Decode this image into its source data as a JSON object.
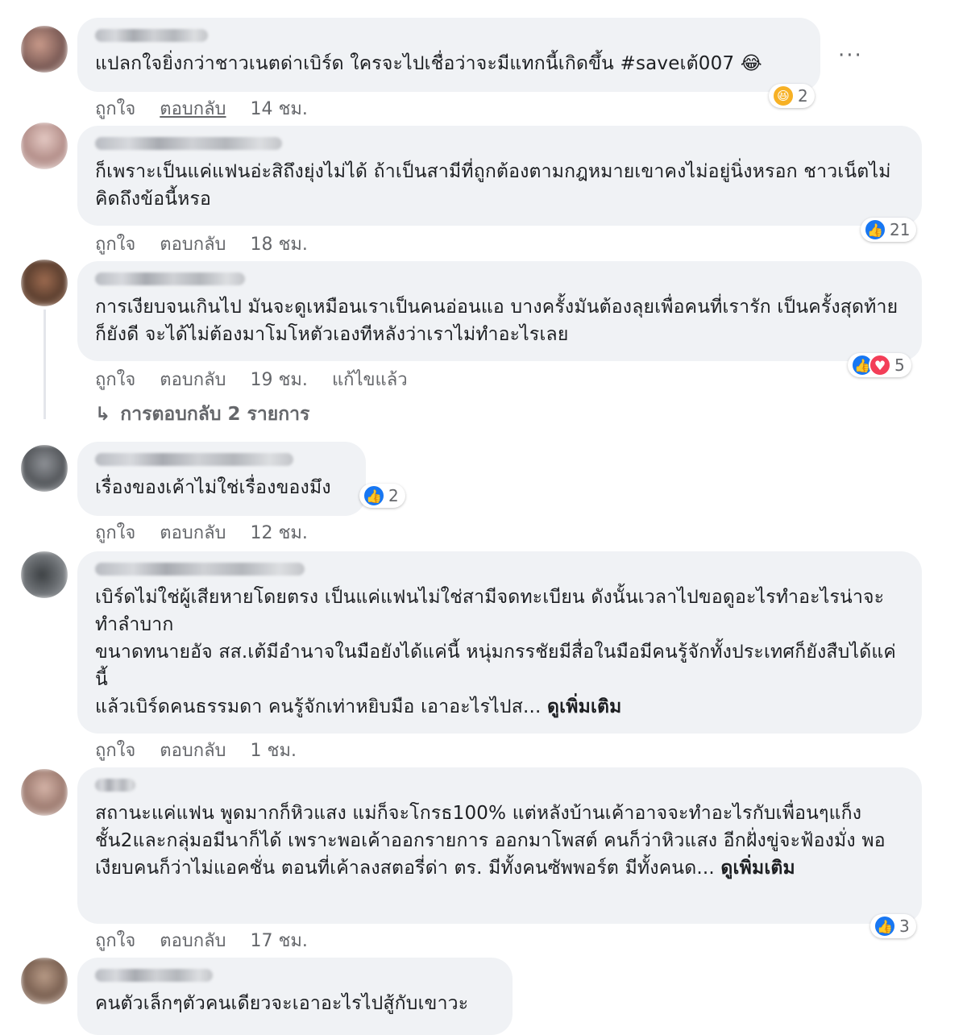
{
  "common": {
    "like_label": "ถูกใจ",
    "reply_label": "ตอบกลับ"
  },
  "colors": {
    "bubble_bg": "#f0f2f5",
    "like_blue": "#1877f2",
    "love_red": "#f33e58",
    "haha_yellow": "#f7b125",
    "meta_gray": "#65676b"
  },
  "comments": [
    {
      "text": "แปลกใจยิ่งกว่าชาวเนตด่าเบิร์ด ใครจะไปเชื่อว่าจะมีแทกนี้เกิดขึ้น #saveเต้007 😂",
      "time": "14 ชม.",
      "reaction_count": "2",
      "reaction_icons": [
        "haha-icon"
      ],
      "more_label": "···"
    },
    {
      "text": "ก็เพราะเป็นแค่แฟนอ่ะสิถึงยุ่งไม่ได้ ถ้าเป็นสามีที่ถูกต้องตามกฎหมายเขาคงไม่อยู่นิ่งหรอก ชาวเน็ตไม่คิดถึงข้อนี้หรอ",
      "time": "18 ชม.",
      "reaction_count": "21",
      "reaction_icons": [
        "like-icon"
      ]
    },
    {
      "text": "การเงียบจนเกินไป มันจะดูเหมือนเราเป็นคนอ่อนแอ บางครั้งมันต้องลุยเพื่อคนที่เรารัก เป็นครั้งสุดท้ายก็ยังดี จะได้ไม่ต้องมาโมโหตัวเองทีหลังว่าเราไม่ทำอะไรเลย",
      "time": "19 ชม.",
      "edited": "แก้ไขแล้ว",
      "reaction_count": "5",
      "reaction_icons": [
        "like-icon",
        "love-icon"
      ],
      "replies_label": "การตอบกลับ 2 รายการ"
    },
    {
      "text": "เรื่องของเค้าไม่ใช่เรื่องของมึง",
      "time": "12 ชม.",
      "reaction_count": "2",
      "reaction_icons": [
        "like-icon"
      ]
    },
    {
      "text": "เบิร์ดไม่ใช่ผู้เสียหายโดยตรง เป็นแค่แฟนไม่ใช่สามีจดทะเบียน ดังนั้นเวลาไปขอดูอะไรทำอะไรน่าจะทำลำบาก\nขนาดทนายอัจ สส.เต้มีอำนาจในมือยังได้แค่นี้ หนุ่มกรรชัยมีสื่อในมือมีคนรู้จักทั้งประเทศก็ยังสืบได้แค่นี้\nแล้วเบิร์ดคนธรรมดา คนรู้จักเท่าหยิบมือ เอาอะไรไปส...",
      "see_more": "ดูเพิ่มเติม",
      "time": "1 ชม."
    },
    {
      "text": "สถานะแค่แฟน พูดมากก็หิวแสง แม่ก็จะโกรธ100% แต่หลังบ้านเค้าอาจจะทำอะไรกับเพื่อนๆแก็งชั้น2และกลุ่มอมีนาก็ได้ เพราะพอเค้าออกรายการ ออกมาโพสต์ คนก็ว่าหิวแสง อีกฝั่งขู่จะฟ้องมั่ง พอเงียบคนก็ว่าไม่แอคชั่น ตอนที่เค้าลงสตอรี่ด่า ตร. มีทั้งคนซัพพอร์ต มีทั้งคนด...",
      "see_more": "ดูเพิ่มเติม",
      "time": "17 ชม.",
      "reaction_count": "3",
      "reaction_icons": [
        "like-icon"
      ]
    },
    {
      "text": "คนตัวเล็กๆตัวคนเดียวจะเอาอะไรไปสู้กับเขาวะ"
    }
  ]
}
